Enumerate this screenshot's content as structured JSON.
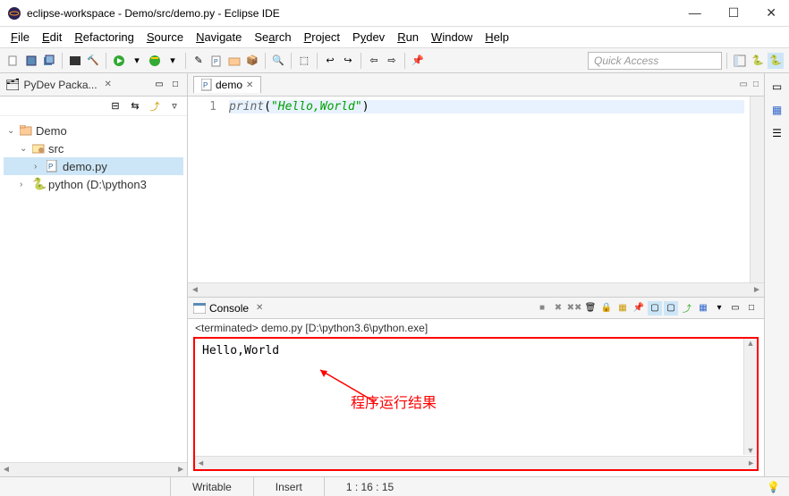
{
  "window": {
    "title": "eclipse-workspace - Demo/src/demo.py - Eclipse IDE"
  },
  "menu": {
    "items": [
      "File",
      "Edit",
      "Refactoring",
      "Source",
      "Navigate",
      "Search",
      "Project",
      "Pydev",
      "Run",
      "Window",
      "Help"
    ]
  },
  "quick_access_placeholder": "Quick Access",
  "sidebar": {
    "view_title": "PyDev Packa...",
    "tree": {
      "project": "Demo",
      "src_folder": "src",
      "file": "demo.py",
      "interpreter": "python  (D:\\python3"
    }
  },
  "editor": {
    "tab_label": "demo",
    "line_number": "1",
    "code": {
      "func": "print",
      "open": "(",
      "string": "\"Hello,World\"",
      "close": ")"
    }
  },
  "console": {
    "view_title": "Console",
    "status": "<terminated> demo.py [D:\\python3.6\\python.exe]",
    "output": "Hello,World",
    "annotation": "程序运行结果"
  },
  "statusbar": {
    "writable": "Writable",
    "insert": "Insert",
    "cursor": "1 : 16 : 15"
  }
}
